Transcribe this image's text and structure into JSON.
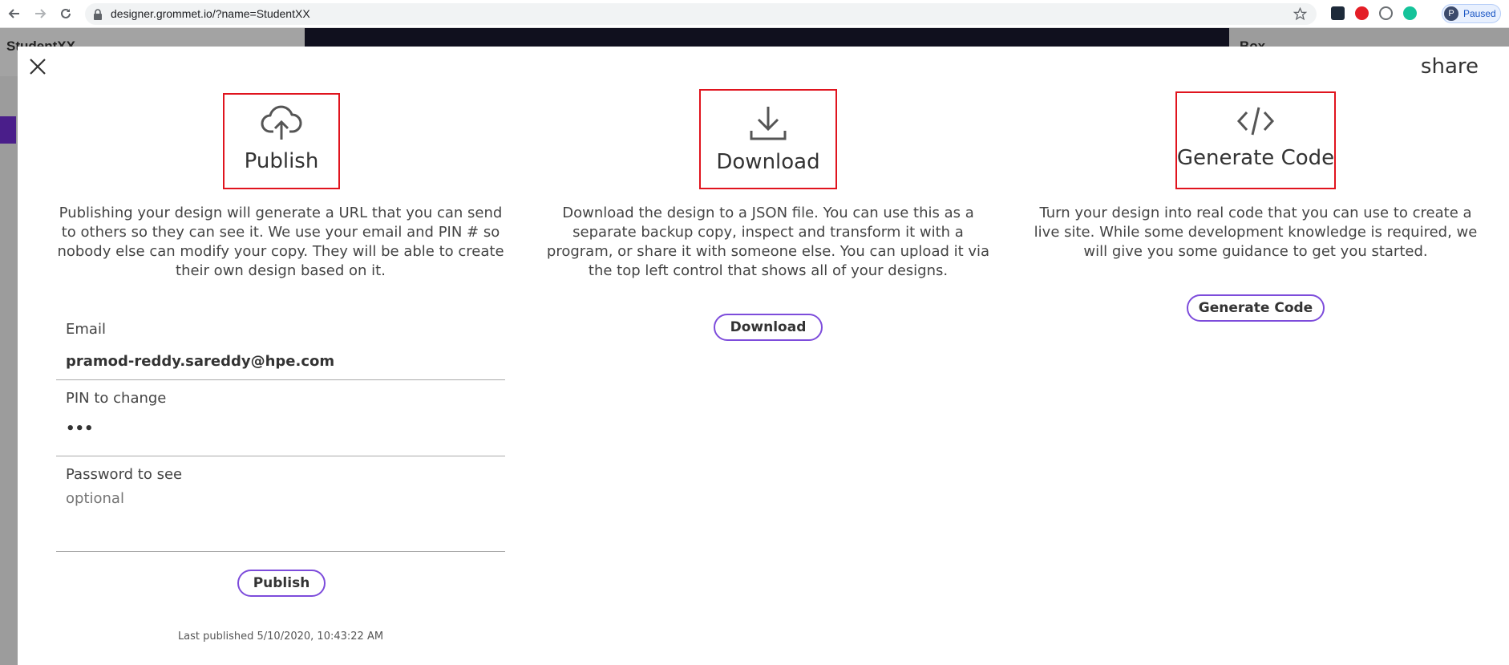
{
  "browser": {
    "url": "designer.grommet.io/?name=StudentXX",
    "profile_initial": "P",
    "profile_status": "Paused"
  },
  "background_app": {
    "title": "StudentXX",
    "right_panel_title": "Box"
  },
  "modal": {
    "title": "share",
    "publish": {
      "heading": "Publish",
      "description": "Publishing your design will generate a URL that you can send to others so they can see it. We use your email and PIN # so nobody else can modify your copy. They will be able to create their own design based on it.",
      "email_label": "Email",
      "email_value": "pramod-reddy.sareddy@hpe.com",
      "pin_label": "PIN to change",
      "pin_value": "•••",
      "password_label": "Password to see",
      "password_placeholder": "optional",
      "button_label": "Publish",
      "last_published": "Last published 5/10/2020, 10:43:22 AM"
    },
    "download": {
      "heading": "Download",
      "description": "Download the design to a JSON file. You can use this as a separate backup copy, inspect and transform it with a program, or share it with someone else. You can upload it via the top left control that shows all of your designs.",
      "button_label": "Download"
    },
    "generate_code": {
      "heading": "Generate Code",
      "description": "Turn your design into real code that you can use to create a live site. While some development knowledge is required, we will give you some guidance to get you started.",
      "button_label": "Generate Code"
    }
  },
  "colors": {
    "accent": "#7d4cdb",
    "highlight_border": "#e0141e"
  }
}
